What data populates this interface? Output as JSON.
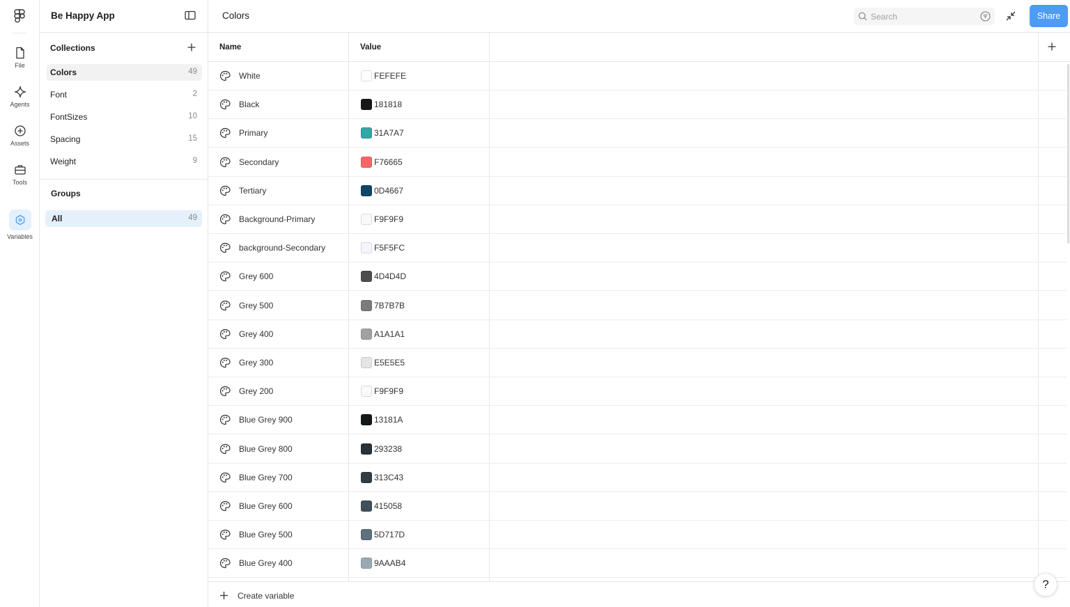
{
  "rail": {
    "items": [
      {
        "label": "File",
        "icon": "file-icon"
      },
      {
        "label": "Agents",
        "icon": "agents-icon"
      },
      {
        "label": "Assets",
        "icon": "assets-icon"
      },
      {
        "label": "Tools",
        "icon": "tools-icon"
      },
      {
        "label": "Variables",
        "icon": "variables-icon",
        "active": true
      }
    ]
  },
  "sidebar": {
    "title": "Be Happy App",
    "collections_title": "Collections",
    "collections": [
      {
        "name": "Colors",
        "count": "49",
        "selected": true
      },
      {
        "name": "Font",
        "count": "2"
      },
      {
        "name": "FontSizes",
        "count": "10"
      },
      {
        "name": "Spacing",
        "count": "15"
      },
      {
        "name": "Weight",
        "count": "9"
      }
    ],
    "groups_title": "Groups",
    "groups": [
      {
        "name": "All",
        "count": "49",
        "selected": true
      }
    ]
  },
  "main": {
    "title": "Colors",
    "search": {
      "placeholder": "Search",
      "value": ""
    },
    "share_label": "Share",
    "columns": {
      "name": "Name",
      "value": "Value"
    },
    "rows": [
      {
        "name": "White",
        "value": "FEFEFE",
        "color": "#FEFEFE"
      },
      {
        "name": "Black",
        "value": "181818",
        "color": "#181818"
      },
      {
        "name": "Primary",
        "value": "31A7A7",
        "color": "#31A7A7"
      },
      {
        "name": "Secondary",
        "value": "F76665",
        "color": "#F76665"
      },
      {
        "name": "Tertiary",
        "value": "0D4667",
        "color": "#0D4667"
      },
      {
        "name": "Background-Primary",
        "value": "F9F9F9",
        "color": "#F9F9F9"
      },
      {
        "name": "background-Secondary",
        "value": "F5F5FC",
        "color": "#F5F5FC"
      },
      {
        "name": "Grey 600",
        "value": "4D4D4D",
        "color": "#4D4D4D"
      },
      {
        "name": "Grey 500",
        "value": "7B7B7B",
        "color": "#7B7B7B"
      },
      {
        "name": "Grey 400",
        "value": "A1A1A1",
        "color": "#A1A1A1"
      },
      {
        "name": "Grey 300",
        "value": "E5E5E5",
        "color": "#E5E5E5"
      },
      {
        "name": "Grey 200",
        "value": "F9F9F9",
        "color": "#F9F9F9"
      },
      {
        "name": "Blue Grey 900",
        "value": "13181A",
        "color": "#13181A"
      },
      {
        "name": "Blue Grey 800",
        "value": "293238",
        "color": "#293238"
      },
      {
        "name": "Blue Grey 700",
        "value": "313C43",
        "color": "#313C43"
      },
      {
        "name": "Blue Grey 600",
        "value": "415058",
        "color": "#415058"
      },
      {
        "name": "Blue Grey 500",
        "value": "5D717D",
        "color": "#5D717D"
      },
      {
        "name": "Blue Grey 400",
        "value": "9AAAB4",
        "color": "#9AAAB4"
      }
    ],
    "create_label": "Create variable",
    "help_label": "?"
  },
  "colors": {
    "accent": "#4D9CF4",
    "selected_group": "#E5F0FD"
  }
}
